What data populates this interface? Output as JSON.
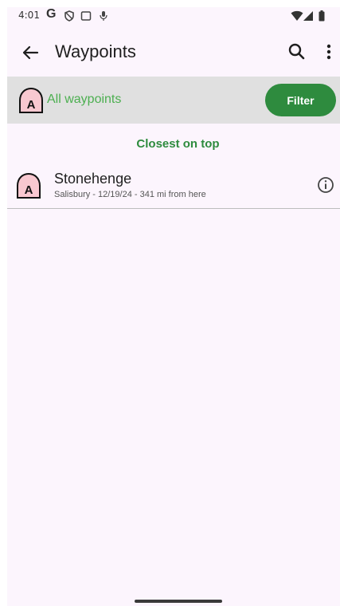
{
  "status_bar": {
    "time": "4:01",
    "g_logo": "G",
    "icons": [
      "shield-icon",
      "screenshot-icon",
      "mic-icon",
      "wifi-icon",
      "cell-signal-icon",
      "battery-icon"
    ]
  },
  "app_bar": {
    "title": "Waypoints",
    "back_icon": "arrow-left-icon",
    "search_icon": "search-icon",
    "more_icon": "more-vert-icon"
  },
  "filter_bar": {
    "label": "All waypoints",
    "button_label": "Filter",
    "icon": "waypoint-marker-icon",
    "icon_letter": "A"
  },
  "sort_label": "Closest on top",
  "waypoints": [
    {
      "name": "Stonehenge",
      "details": "Salisbury - 12/19/24 - 341 mi from here",
      "icon_letter": "A"
    }
  ],
  "colors": {
    "accent_green": "#2e8b3e",
    "label_green": "#4caf50",
    "marker_fill": "#f8c8d0",
    "background": "#fcf5fd"
  }
}
